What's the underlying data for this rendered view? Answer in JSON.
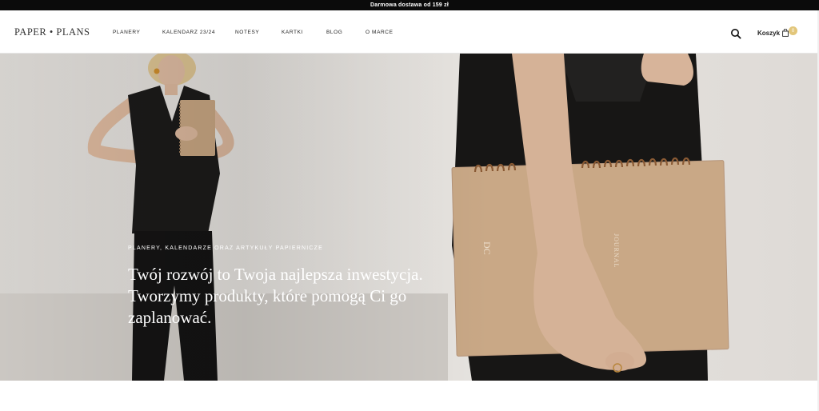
{
  "announcement": {
    "text": "Darmowa dostawa od 159 zł"
  },
  "header": {
    "logo": "PAPER • PLANS",
    "nav": [
      {
        "label": "PLANERY"
      },
      {
        "label": "KALENDARZ 23/24"
      },
      {
        "label": "NOTESY"
      },
      {
        "label": "KARTKI"
      },
      {
        "label": "BLOG"
      },
      {
        "label": "O MARCE"
      }
    ],
    "search_icon": "search-icon",
    "cart": {
      "label": "Koszyk",
      "count": "0",
      "icon": "shopping-bag-icon"
    }
  },
  "hero": {
    "eyebrow": "PLANERY, KALENDARZE ORAZ ARTYKUŁY PAPIERNICZE",
    "heading": "Twój rozwój to Twoja najlepsza inwestycja. Tworzymy produkty, które pomogą Ci go zaplanować.",
    "notebook_cover_texts": [
      "DC",
      "JOURNAL"
    ]
  },
  "colors": {
    "topbar_bg": "#0b0b0b",
    "accent_badge": "#e2c67a",
    "notebook": "#c9a886"
  }
}
